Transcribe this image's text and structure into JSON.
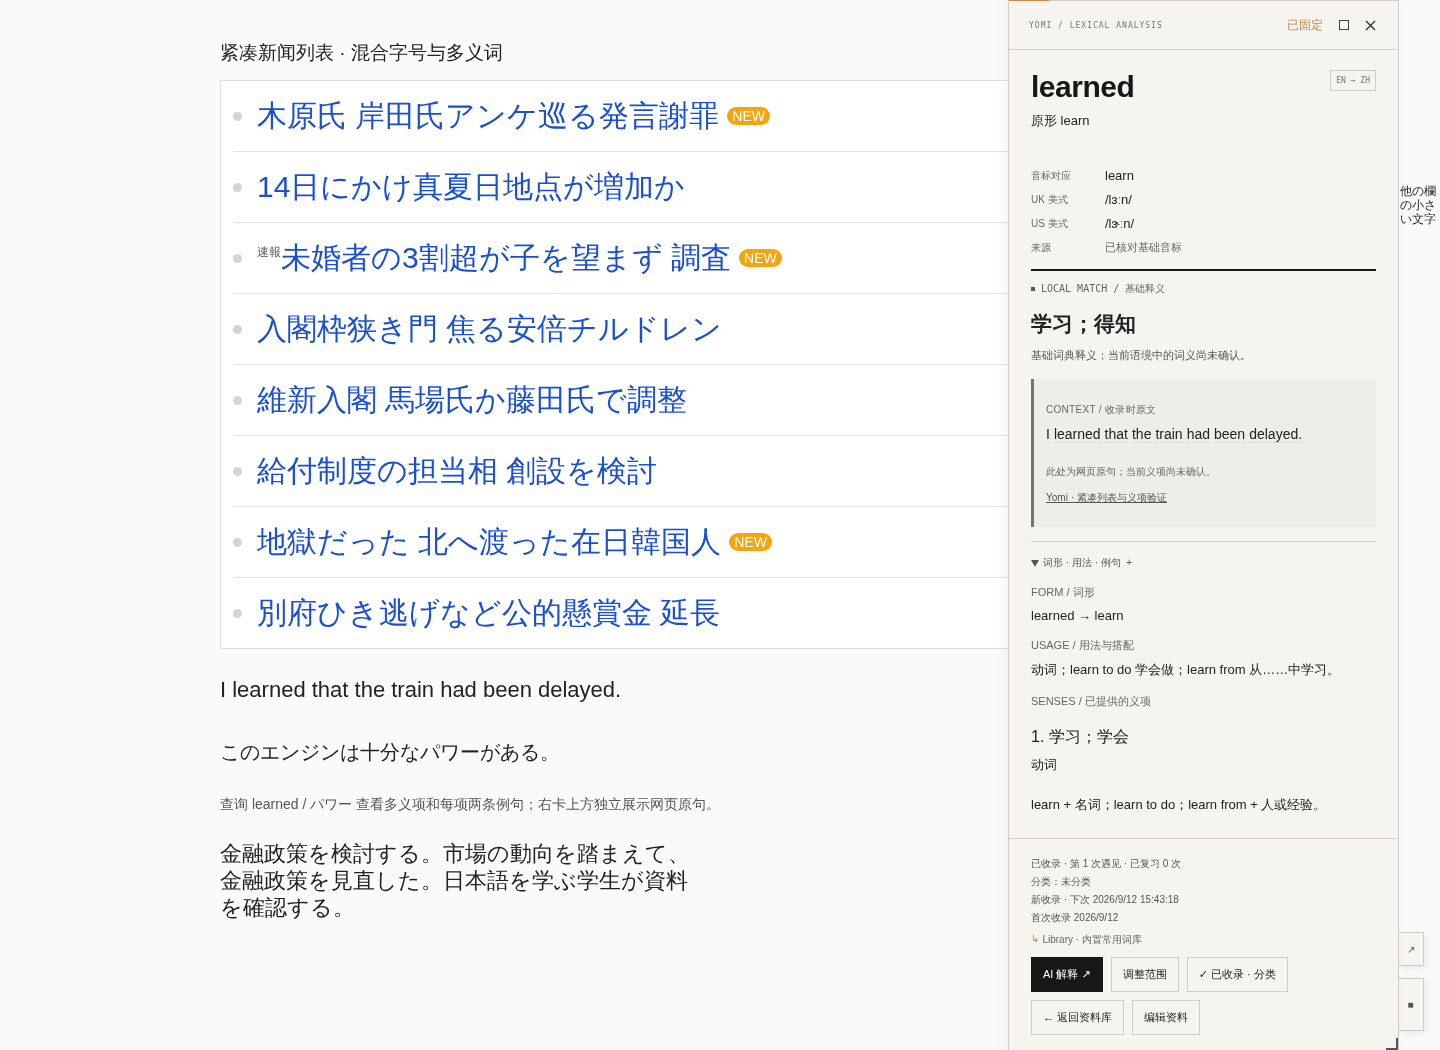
{
  "page_title": "紧凑新闻列表 · 混合字号与多义词",
  "news": [
    {
      "headline": "木原氏 岸田氏アンケ巡る発言謝罪",
      "new": true,
      "badge": "NEW"
    },
    {
      "headline": "14日にかけ真夏日地点が増加か",
      "new": false
    },
    {
      "prefix": "速報",
      "headline": "未婚者の3割超が子を望まず 調査",
      "new": true,
      "badge": "NEW"
    },
    {
      "headline": "入閣枠狭き門 焦る安倍チルドレン",
      "new": false
    },
    {
      "headline": "維新入閣 馬場氏か藤田氏で調整",
      "new": false
    },
    {
      "headline": "給付制度の担当相 創設を検討",
      "new": false
    },
    {
      "headline": "地獄だった 北へ渡った在日韓国人",
      "new": true,
      "badge": "NEW"
    },
    {
      "headline": "別府ひき逃げなど公的懸賞金 延長",
      "new": false
    }
  ],
  "sentence_en": "I learned that the train had been delayed.",
  "sentence_ja": "このエンジンは十分なパワーがある。",
  "hint": "查询 learned / パワー 查看多义项和每项两条例句；右卡上方独立展示网页原句。",
  "paragraph": "金融政策を検討する。市場の動向を踏まえて、金融政策を見直した。日本語を学ぶ学生が資料を確認する。",
  "side_note": "他の欄の小さい文字",
  "floating_buttons": [
    "↗",
    "■"
  ],
  "panel": {
    "breadcrumb": "YOMI / LEXICAL ANALYSIS",
    "pinned_label": "已固定",
    "word": "learned",
    "lang_pair": "EN → ZH",
    "lemma": "原形 learn",
    "phonetics": [
      {
        "label": "音标对应",
        "value": "learn",
        "kind": "main"
      },
      {
        "label": "UK 美式",
        "value": "/lɜːn/",
        "kind": "main"
      },
      {
        "label": "US 美式",
        "value": "/lɝːn/",
        "kind": "main"
      },
      {
        "label": "来源",
        "value": "已核对基础音标",
        "kind": "muted"
      }
    ],
    "match_label": "LOCAL MATCH / 基础释义",
    "meaning": "学习；得知",
    "meaning_note": "基础词典释义；当前语境中的词义尚未确认。",
    "context": {
      "label": "CONTEXT / 收录时原文",
      "words": [
        "I",
        "learned",
        "that",
        "the",
        "train",
        "had",
        "been",
        "delayed."
      ],
      "note": "此处为网页原句；当前义项尚未确认。",
      "link": "Yomi · 紧凑列表与义项验证"
    },
    "details": {
      "title": "词形 · 用法 · 例句",
      "mark": "+",
      "expanded": true
    },
    "sections": [
      {
        "label": "FORM / 词形",
        "text": "learned → learn"
      },
      {
        "label": "USAGE / 用法与搭配",
        "text": "动词；learn to do 学会做；learn from 从……中学习。"
      }
    ],
    "senses_label": "SENSES / 已提供的义项",
    "senses": [
      {
        "title": "1. 学习；学会",
        "pos": "动词",
        "pattern": "learn + 名词；learn to do；learn from + 人或经验。"
      }
    ],
    "stats": [
      "已收录 · 第 1 次遇见 · 已复习 0 次",
      "分类：未分类",
      "新收录 · 下次 2026/9/12 15:43:18",
      "首次收录 2026/9/12"
    ],
    "library": {
      "mark": "↳",
      "text": "Library · 内置常用词库"
    },
    "button_rows": [
      [
        {
          "label": "AI 解释 ↗",
          "kind": "primary"
        },
        {
          "label": "调整范围",
          "kind": "secondary"
        },
        {
          "label": "✓ 已收录 · 分类",
          "kind": "secondary"
        }
      ],
      [
        {
          "label": "← 返回资料库",
          "kind": "secondary"
        },
        {
          "label": "编辑资料",
          "kind": "secondary"
        }
      ]
    ]
  }
}
